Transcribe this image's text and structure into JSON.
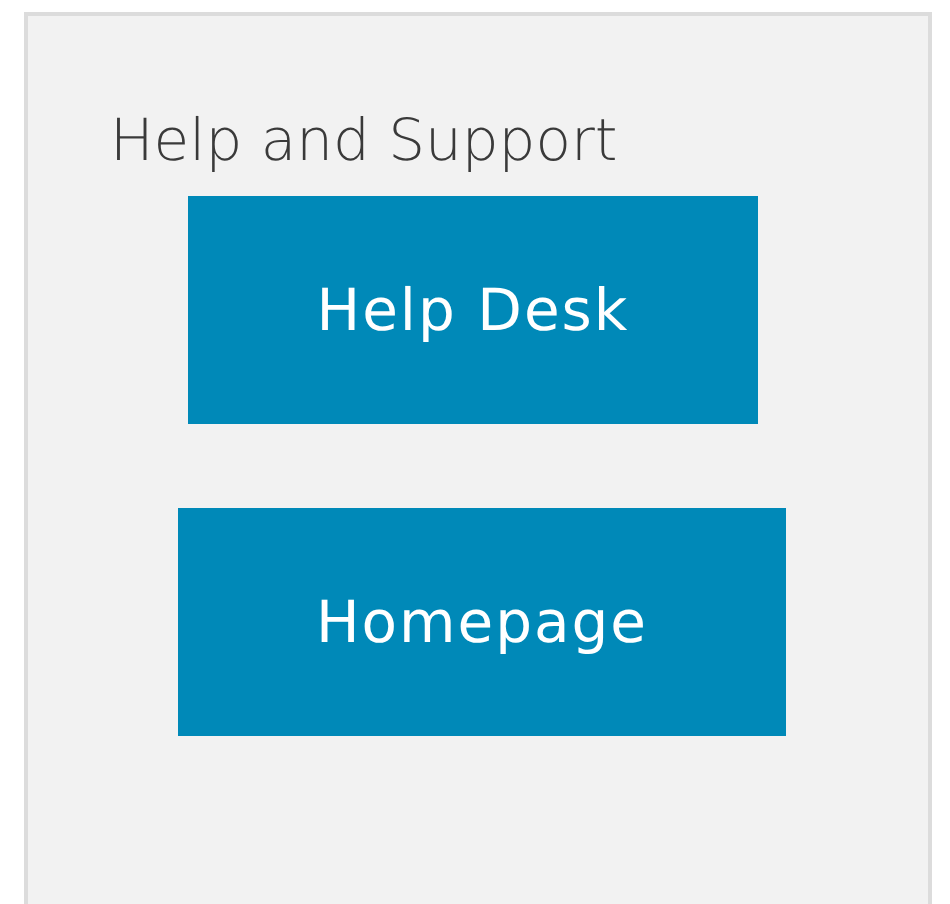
{
  "panel": {
    "title": "Help and Support",
    "buttons": [
      {
        "label": "Help Desk"
      },
      {
        "label": "Homepage"
      }
    ]
  }
}
